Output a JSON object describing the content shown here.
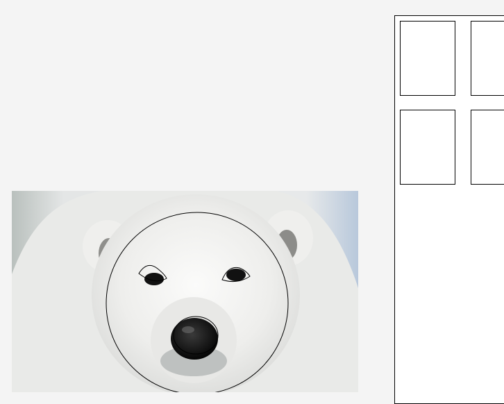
{
  "image": {
    "subject_icon": "polar-bear-face-photo"
  },
  "overlay": {
    "shapes": [
      "face-outline",
      "left-eye-outline",
      "right-eye-outline",
      "nose-outline"
    ],
    "stroke_color": "#000000"
  },
  "thumbnail_panel": {
    "slots": [
      {
        "label": ""
      },
      {
        "label": ""
      },
      {
        "label": ""
      },
      {
        "label": ""
      }
    ]
  },
  "colors": {
    "page_background": "#f4f4f4",
    "panel_background": "#ffffff",
    "fur": "#f1f1ef",
    "background_snow": "#d7dee4"
  }
}
